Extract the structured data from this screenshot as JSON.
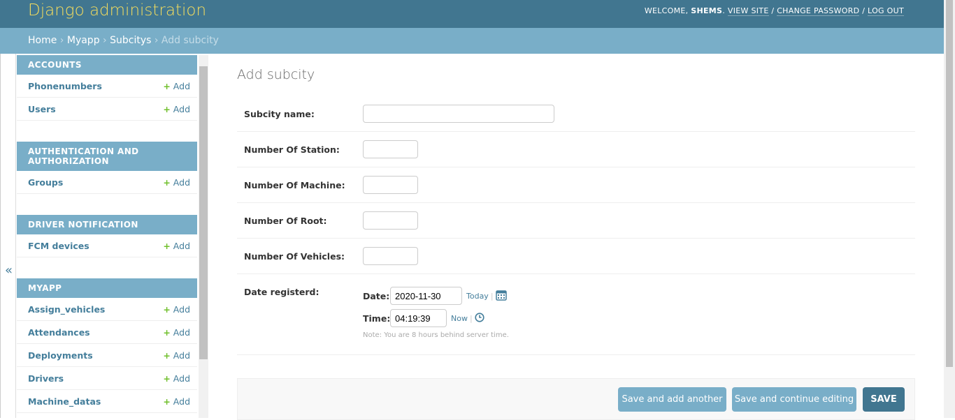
{
  "header": {
    "brand": "Django administration",
    "welcome": "Welcome,",
    "username": "SHEMS",
    "view_site": "View site",
    "change_password": "Change password",
    "log_out": "Log out"
  },
  "breadcrumbs": {
    "home": "Home",
    "app": "Myapp",
    "model": "Subcitys",
    "current": "Add subcity",
    "sep": "›"
  },
  "sidebar": {
    "toggle": "«",
    "add_label": "Add",
    "modules": [
      {
        "caption": "ACCOUNTS",
        "items": [
          {
            "name": "Phonenumbers"
          },
          {
            "name": "Users"
          }
        ]
      },
      {
        "caption": "AUTHENTICATION AND AUTHORIZATION",
        "items": [
          {
            "name": "Groups"
          }
        ]
      },
      {
        "caption": "DRIVER NOTIFICATION",
        "items": [
          {
            "name": "FCM devices"
          }
        ]
      },
      {
        "caption": "MYAPP",
        "items": [
          {
            "name": "Assign_vehicles"
          },
          {
            "name": "Attendances"
          },
          {
            "name": "Deployments"
          },
          {
            "name": "Drivers"
          },
          {
            "name": "Machine_datas"
          }
        ]
      }
    ]
  },
  "form": {
    "title": "Add subcity",
    "fields": {
      "subcity_name": {
        "label": "Subcity name:",
        "value": ""
      },
      "num_station": {
        "label": "Number Of Station:",
        "value": ""
      },
      "num_machine": {
        "label": "Number Of Machine:",
        "value": ""
      },
      "num_root": {
        "label": "Number Of Root:",
        "value": ""
      },
      "num_vehicles": {
        "label": "Number Of Vehicles:",
        "value": ""
      }
    },
    "date_registerd": {
      "label": "Date registerd:",
      "date_label": "Date:",
      "date_value": "2020-11-30",
      "today": "Today",
      "time_label": "Time:",
      "time_value": "04:19:39",
      "now": "Now",
      "sep": "|",
      "note": "Note: You are 8 hours behind server time."
    }
  },
  "actions": {
    "save_add_another": "Save and add another",
    "save_continue": "Save and continue editing",
    "save": "SAVE"
  },
  "colors": {
    "header": "#417690",
    "breadcrumbs": "#79aec8",
    "brand": "#f5dd5d",
    "link": "#447e9b",
    "add_plus": "#70bf2b"
  }
}
